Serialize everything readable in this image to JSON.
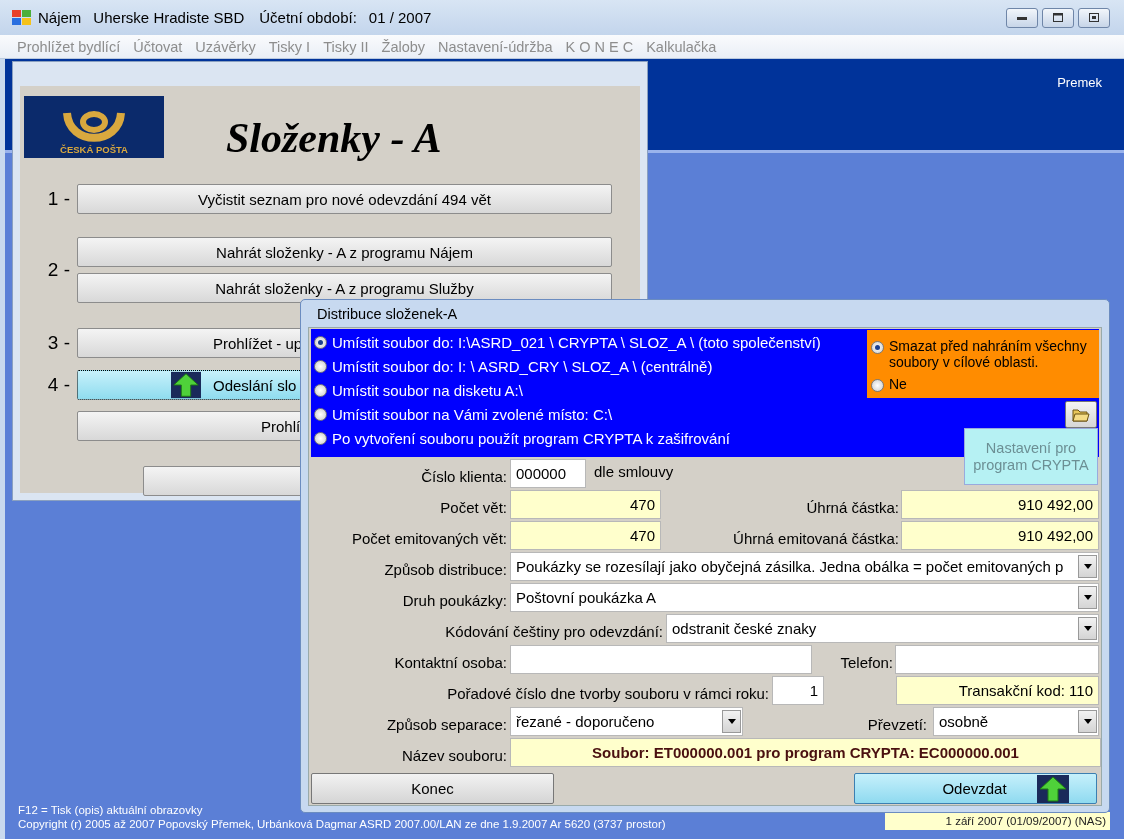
{
  "window": {
    "app": "Nájem",
    "organization": "Uherske Hradiste SBD",
    "period_label": "Účetní období:",
    "period": "01 / 2007"
  },
  "menu": [
    {
      "label": "Prohlížet bydlící",
      "disabled": true
    },
    {
      "label": "Účtovat",
      "disabled": true
    },
    {
      "label": "Uzávěrky",
      "disabled": true
    },
    {
      "label": "Tisky I",
      "disabled": true
    },
    {
      "label": "Tisky II",
      "disabled": true
    },
    {
      "label": "Žaloby",
      "disabled": true
    },
    {
      "label": "Nastavení-údržba",
      "disabled": true
    },
    {
      "label": "K O N E C",
      "disabled": true
    },
    {
      "label": "Kalkulačka",
      "disabled": true
    }
  ],
  "user": "Premek",
  "slozenky": {
    "logo_text": "ČESKÁ POŠTA",
    "title": "Složenky - A",
    "steps": [
      {
        "number": "1 -",
        "buttons": [
          {
            "label": "Vyčistit seznam pro nové odevzdání 494 vět",
            "selected": false
          }
        ]
      },
      {
        "number": "2 -",
        "buttons": [
          {
            "label": "Nahrát složenky - A z programu Nájem",
            "selected": false
          },
          {
            "label": "Nahrát složenky - A z programu Služby",
            "selected": false
          }
        ]
      },
      {
        "number": "3 -",
        "buttons": [
          {
            "label": "Prohlížet - up",
            "selected": false
          }
        ]
      },
      {
        "number": "4 -",
        "buttons": [
          {
            "label": "Odeslání slo",
            "selected": true
          }
        ]
      },
      {
        "buttons": [
          {
            "label": "Prohlí",
            "selected": false
          }
        ]
      },
      {
        "buttons": [
          {
            "selected": false
          }
        ]
      }
    ]
  },
  "dialog": {
    "title": "Distribuce složenek-A",
    "targets": [
      {
        "label": "Umístit soubor do: I:\\ASRD_021 \\ CRYPTA \\ SLOZ_A \\ (toto společenství)",
        "selected": true
      },
      {
        "label": "Umístit soubor do: I: \\ ASRD_CRY \\ SLOZ_A \\    (centrálně)",
        "selected": false
      },
      {
        "label": "Umístit soubor na disketu A:\\",
        "selected": false
      },
      {
        "label": "Umístit soubor na Vámi zvolené místo: C:\\",
        "selected": false
      },
      {
        "label": "Po vytvoření souboru použít program CRYPTA k zašifrování",
        "selected": false
      }
    ],
    "delete_options": [
      {
        "label": "Smazat před nahráním všechny soubory v cílové oblasti.",
        "selected": true
      },
      {
        "label": "Ne",
        "selected": false
      }
    ],
    "crypta_button": {
      "label": "Nastavení pro program CRYPTA",
      "disabled": true
    },
    "client_number": {
      "label": "Číslo klienta:",
      "value": "000000",
      "note": "dle smlouvy"
    },
    "record_count": {
      "label": "Počet vět:",
      "value": "470"
    },
    "total": {
      "label": "Úhrná částka:",
      "value": "910 492,00"
    },
    "emitted_count": {
      "label": "Počet emitovaných vět:",
      "value": "470"
    },
    "emitted_total": {
      "label": "Úhrná emitovaná částka:",
      "value": "910 492,00"
    },
    "distribution": {
      "label": "Způsob distribuce:",
      "value": "Poukázky se rozesílají jako obyčejná zásilka.  Jedna obálka = počet emitovaných p"
    },
    "slip_type": {
      "label": "Druh poukázky:",
      "value": "Poštovní poukázka A"
    },
    "encoding": {
      "label": "Kódování češtiny pro odevzdání:",
      "value": "odstranit české znaky"
    },
    "contact": {
      "label": "Kontaktní osoba:"
    },
    "phone": {
      "label": "Telefon:"
    },
    "sequence": {
      "label": "Pořadové číslo dne tvorby souboru v rámci roku:",
      "value": "1"
    },
    "transaction_code": "Transakční kod: 110",
    "separation": {
      "label": "Způsob separace:",
      "value": "řezané - doporučeno"
    },
    "pickup": {
      "label": "Převzetí:",
      "value": "osobně"
    },
    "file_name": {
      "label": "Název souboru:",
      "value": "Soubor: ET000000.001 pro program CRYPTA: EC000000.001"
    },
    "buttons": [
      {
        "label": "Konec",
        "kind": "close"
      },
      {
        "label": "Odevzdat",
        "kind": "submit"
      }
    ]
  },
  "status": {
    "hint": "F12 = Tisk (opis) aktuální obrazovky",
    "copyright": "Copyright (r) 2005 až 2007 Popovský Přemek, Urbánková Dagmar  ASRD 2007.00/LAN ze dne 1.9.2007 Ar 5620 (3737 prostor)",
    "date": "1 září 2007 (01/09/2007) (NAS)"
  }
}
